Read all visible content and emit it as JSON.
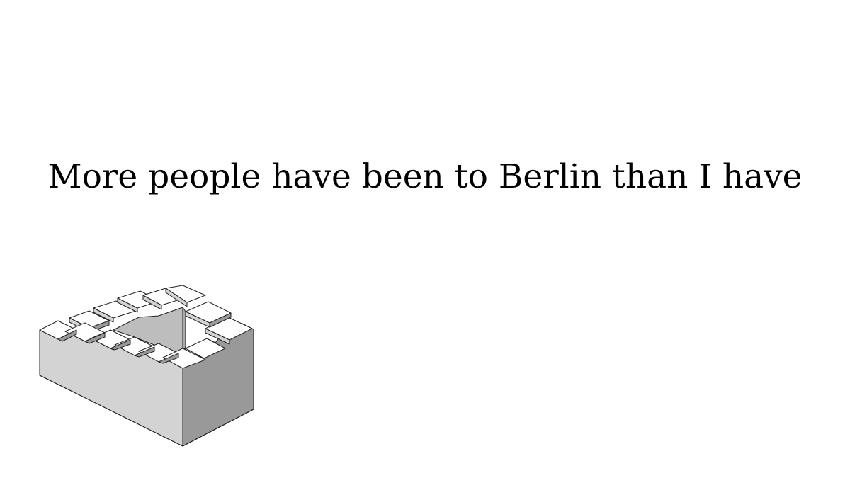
{
  "caption": {
    "text": "More people have been to Berlin than I have"
  },
  "illustration": {
    "icon": "penrose-stairs-icon",
    "colors": {
      "top": "#ffffff",
      "left_face": "#d3d3d3",
      "right_face": "#999999",
      "inner_wall": "#bdbdbd",
      "stroke": "#222222"
    }
  }
}
